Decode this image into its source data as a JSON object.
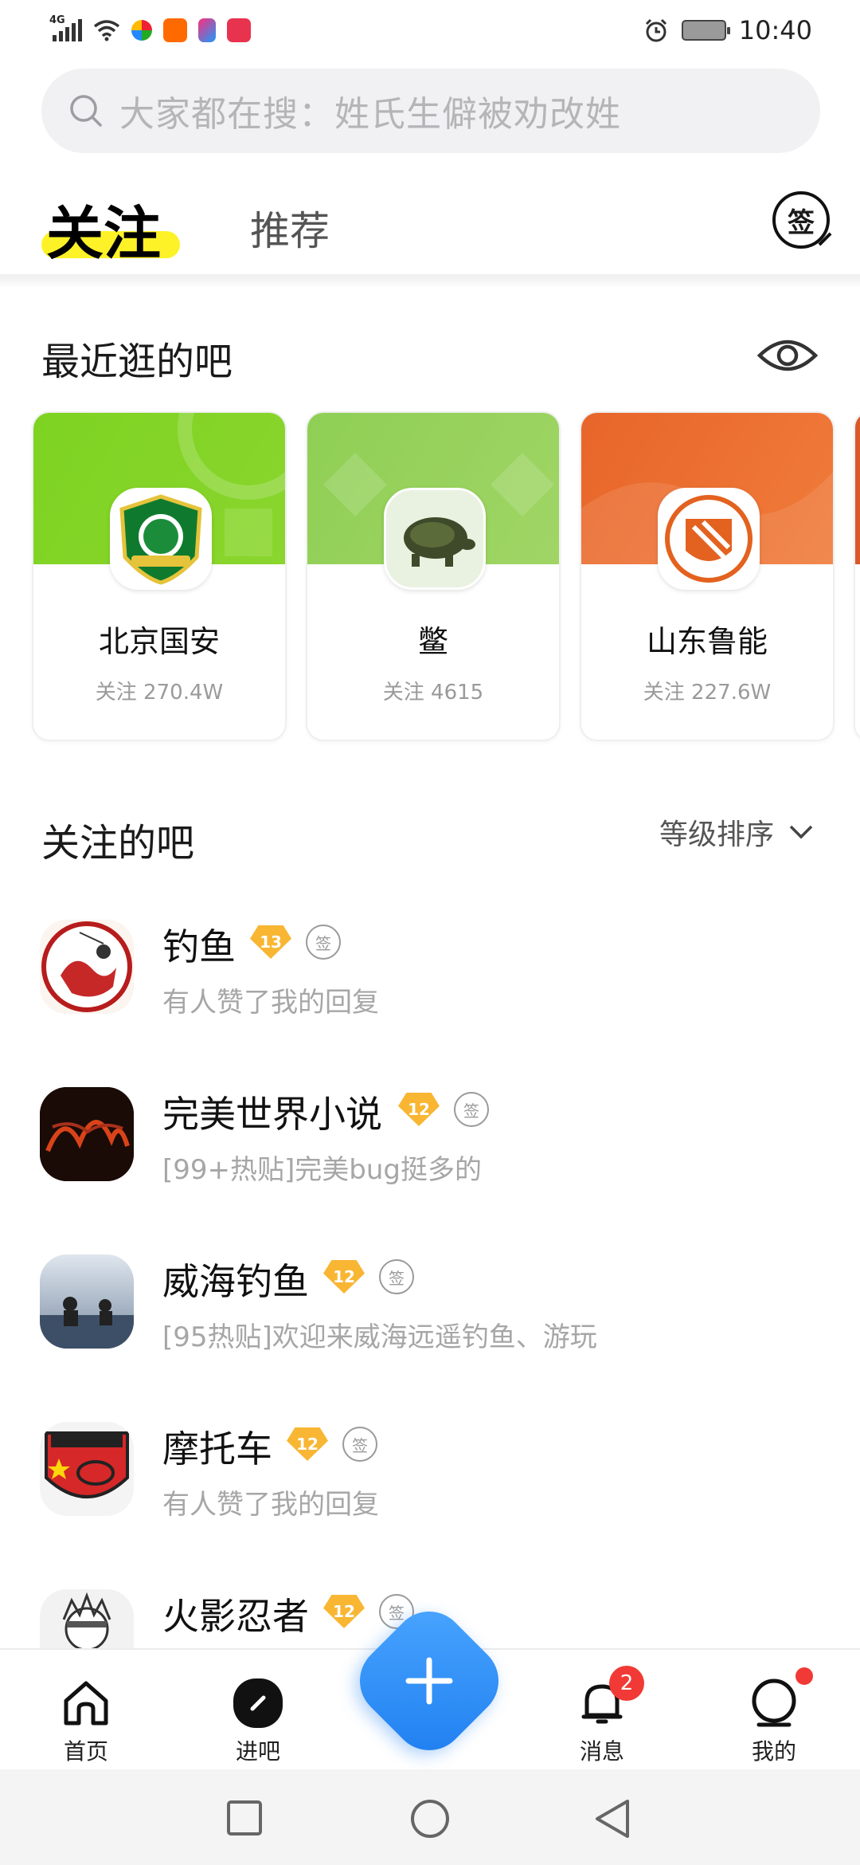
{
  "status_bar": {
    "network": "4G",
    "time": "10:40"
  },
  "search": {
    "placeholder": "大家都在搜：姓氏生僻被劝改姓"
  },
  "tabs": {
    "follow": "关注",
    "recommend": "推荐",
    "sign_label": "签"
  },
  "recent": {
    "title": "最近逛的吧",
    "cards": [
      {
        "name": "北京国安",
        "count": "关注 270.4W",
        "banner_color": "#7ed321"
      },
      {
        "name": "鳖",
        "count": "关注 4615",
        "banner_color": "#98d25a"
      },
      {
        "name": "山东鲁能",
        "count": "关注 227.6W",
        "banner_color": "#ea6a2c"
      }
    ]
  },
  "followed": {
    "title": "关注的吧",
    "sort_label": "等级排序",
    "sign_mini": "签",
    "items": [
      {
        "name": "钓鱼",
        "level": "13",
        "subtitle": "有人赞了我的回复"
      },
      {
        "name": "完美世界小说",
        "level": "12",
        "subtitle": "[99+热贴]完美bug挺多的"
      },
      {
        "name": "威海钓鱼",
        "level": "12",
        "subtitle": "[95热贴]欢迎来威海远遥钓鱼、游玩"
      },
      {
        "name": "摩托车",
        "level": "12",
        "subtitle": "有人赞了我的回复"
      },
      {
        "name": "火影忍者",
        "level": "12",
        "subtitle": ""
      }
    ]
  },
  "bottom_nav": {
    "home": "首页",
    "enter": "进吧",
    "messages": "消息",
    "messages_badge": "2",
    "mine": "我的"
  },
  "colors": {
    "accent_yellow": "#fdf228",
    "fab_blue": "#1e7ef0",
    "badge_red": "#f13a35",
    "level_gold": "#f8b633"
  }
}
